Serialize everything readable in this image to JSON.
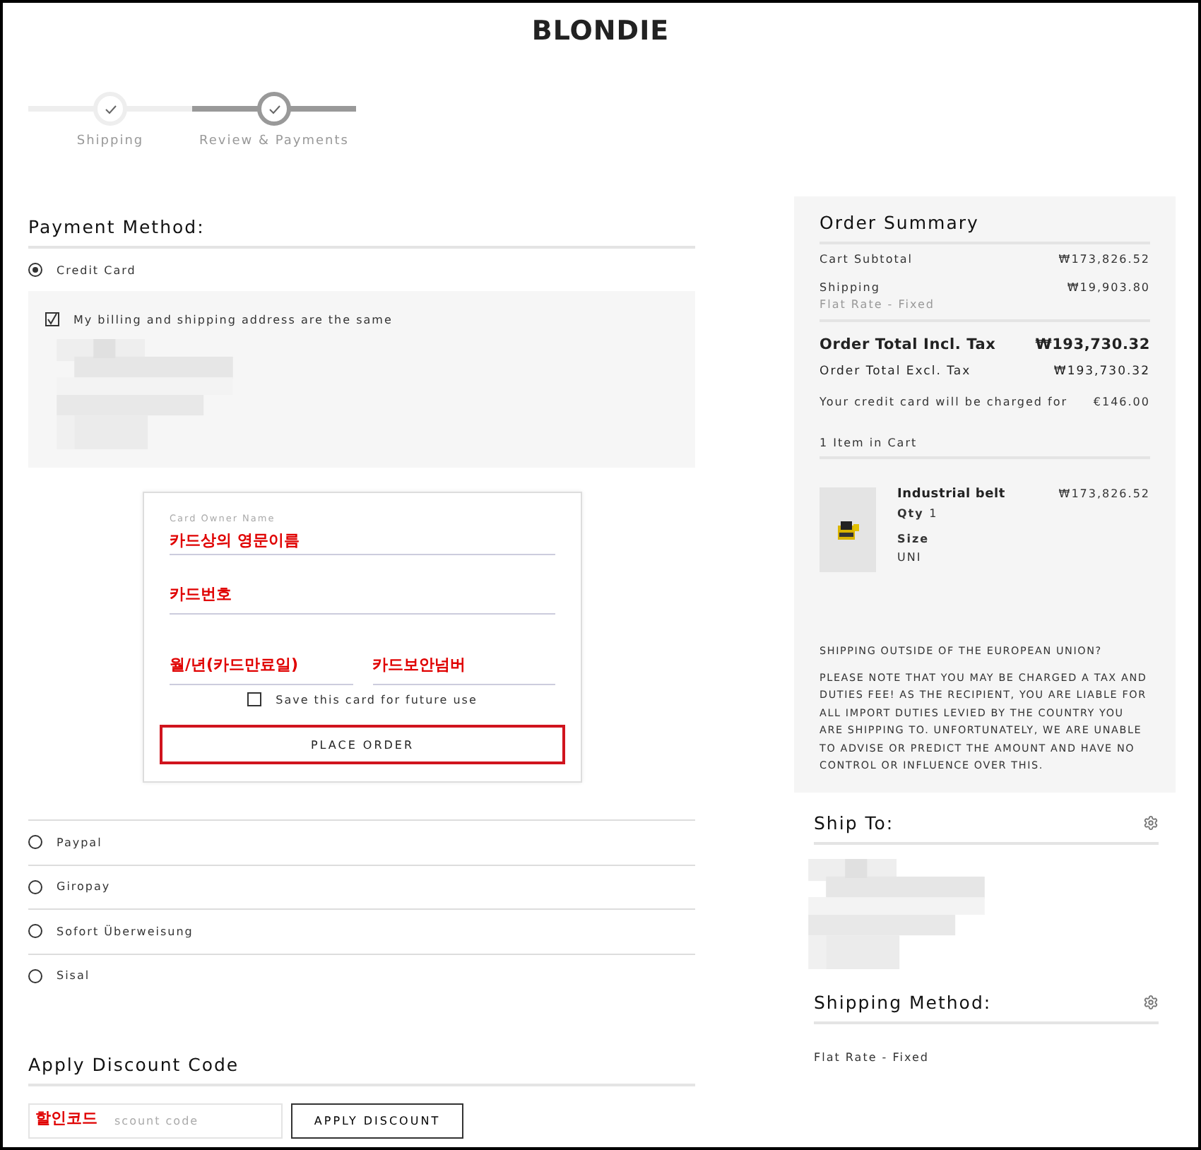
{
  "logo": "BLONDIE",
  "steps": [
    {
      "label": "Shipping",
      "selected": false
    },
    {
      "label": "Review & Payments",
      "selected": true
    }
  ],
  "payment": {
    "title": "Payment Method:",
    "methods": [
      {
        "label": "Credit Card",
        "selected": true
      },
      {
        "label": "Paypal",
        "selected": false
      },
      {
        "label": "Giropay",
        "selected": false
      },
      {
        "label": "Sofort Überweisung",
        "selected": false
      },
      {
        "label": "Sisal",
        "selected": false
      }
    ],
    "billing": {
      "label": "My billing and shipping address are the same",
      "checked": true
    },
    "card_form": {
      "fields": [
        {
          "label": "Card Owner Name",
          "annotation": "카드상의 영문이름"
        },
        {
          "annotation": "카드번호"
        },
        {
          "annotation": "월/년(카드만료일)"
        },
        {
          "annotation": "카드보안넘버"
        }
      ],
      "save_card": {
        "label": "Save this card for future use",
        "checked": false
      },
      "button": "PLACE ORDER"
    }
  },
  "discount": {
    "title": "Apply Discount Code",
    "annotation": "할인코드",
    "placeholder": "scount code",
    "button": "APPLY DISCOUNT"
  },
  "summary": {
    "title": "Order Summary",
    "rows": [
      {
        "label": "Cart Subtotal",
        "value": "₩173,826.52"
      },
      {
        "label": "Shipping",
        "sub": "Flat Rate - Fixed",
        "value": "₩19,903.80"
      }
    ],
    "total_incl": {
      "label": "Order Total Incl. Tax",
      "value": "₩193,730.32"
    },
    "total_excl": {
      "label": "Order Total Excl. Tax",
      "value": "₩193,730.32"
    },
    "charged": {
      "label": "Your credit card will be charged for",
      "value": "€146.00"
    },
    "items_count": "1 Item in Cart",
    "item": {
      "name": "Industrial belt",
      "qty_label": "Qty",
      "qty": "1",
      "size_label": "Size",
      "size": "UNI",
      "price": "₩173,826.52"
    },
    "notice_title": "SHIPPING OUTSIDE OF THE EUROPEAN UNION?",
    "notice": "PLEASE NOTE THAT YOU MAY BE CHARGED A TAX AND DUTIES FEE! AS THE RECIPIENT, YOU ARE LIABLE FOR ALL IMPORT DUTIES LEVIED BY THE COUNTRY YOU ARE SHIPPING TO. UNFORTUNATELY, WE ARE UNABLE TO ADVISE OR PREDICT THE AMOUNT AND HAVE NO CONTROL OR INFLUENCE OVER THIS."
  },
  "ship_to": {
    "title": "Ship To:"
  },
  "shipping_method": {
    "title": "Shipping Method:",
    "value": "Flat Rate - Fixed"
  }
}
